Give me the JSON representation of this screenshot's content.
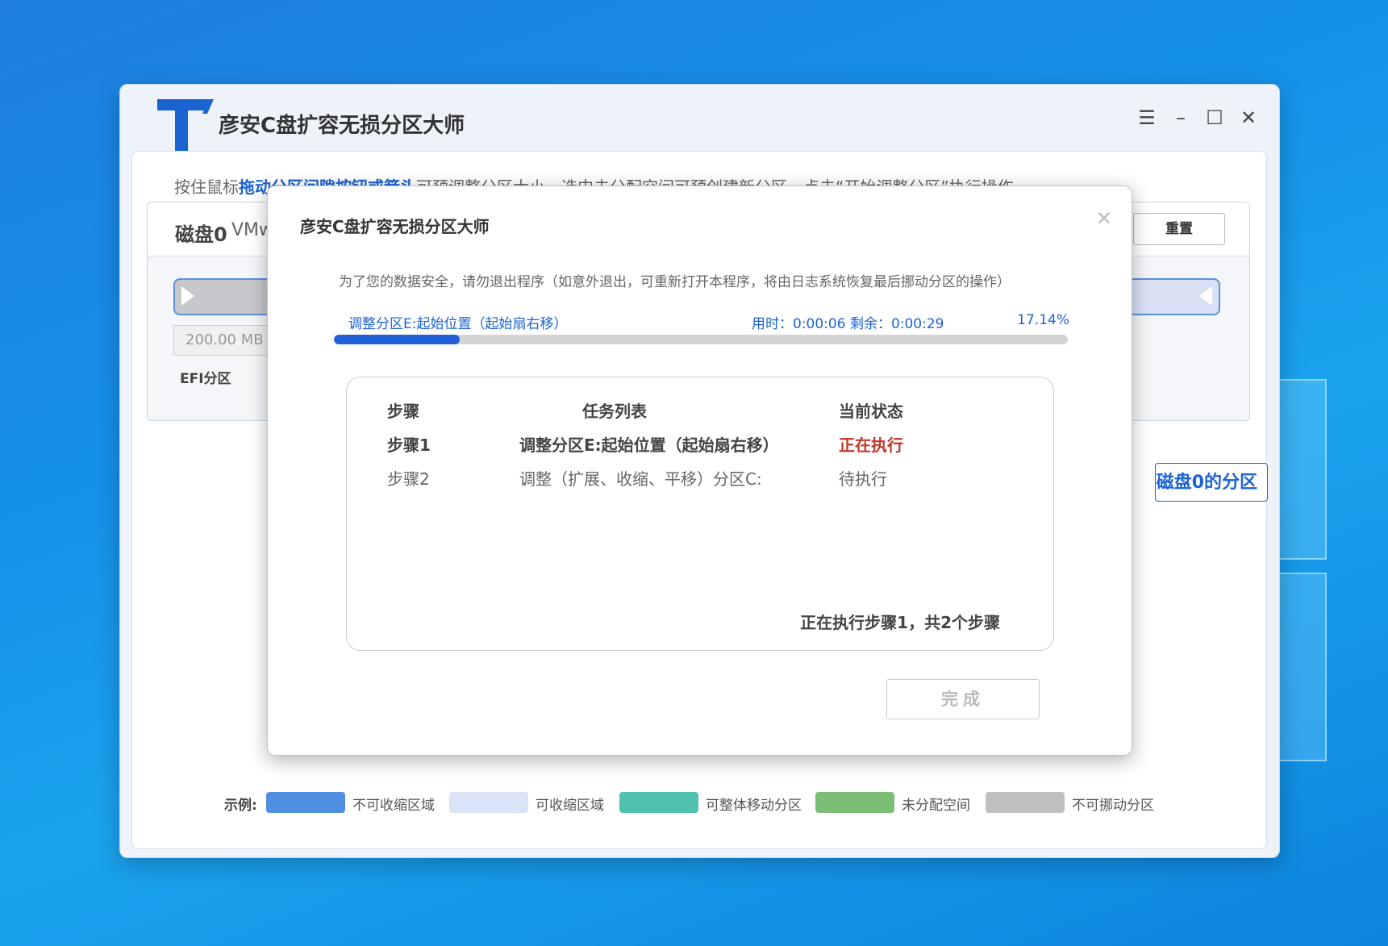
{
  "app": {
    "title": "彦安C盘扩容无损分区大师",
    "accent": "#1c63d2"
  },
  "window_controls": {
    "menu_icon": "menu-icon",
    "minimize_icon": "minimize-icon",
    "maximize_icon": "maximize-icon",
    "close_icon": "close-icon"
  },
  "hint": {
    "prefix": "按住鼠标",
    "highlight": "拖动分区间隙按钮或箭头",
    "suffix": "可预调整分区大小，选中未分配空间可预创建新分区，点击“开始调整分区”执行操作"
  },
  "disk": {
    "name": "磁盘0",
    "model": "VMw",
    "reset_label": "重置",
    "efi_size": "200.00 MB",
    "efi_label": "EFI分区",
    "partitions_button": "磁盘0的分区"
  },
  "legend": {
    "label": "示例:",
    "items": [
      {
        "label": "不可收缩区域",
        "color": "#4f8ee0"
      },
      {
        "label": "可收缩区域",
        "color": "#dbe3f7"
      },
      {
        "label": "可整体移动分区",
        "color": "#4fc1ae"
      },
      {
        "label": "未分配空间",
        "color": "#7bbf77"
      },
      {
        "label": "不可挪动分区",
        "color": "#c0c0c0"
      }
    ]
  },
  "dialog": {
    "title": "彦安C盘扩容无损分区大师",
    "close_icon": "close-icon",
    "notice": "为了您的数据安全，请勿退出程序（如意外退出，可重新打开本程序，将由日志系统恢复最后挪动分区的操作）",
    "progress": {
      "task": "调整分区E:起始位置（起始扇右移）",
      "time": "用时：0:00:06  剩余：0:00:29",
      "percent_label": "17.14%",
      "fraction": 0.1714
    },
    "table": {
      "headers": [
        "步骤",
        "任务列表",
        "当前状态"
      ],
      "rows": [
        {
          "step": "步骤1",
          "task": "调整分区E:起始位置（起始扇右移）",
          "status": "正在执行"
        },
        {
          "step": "步骤2",
          "task": "调整（扩展、收缩、平移）分区C:",
          "status": "待执行"
        }
      ],
      "footer": "正在执行步骤1，共2个步骤"
    },
    "done_label": "完成"
  }
}
